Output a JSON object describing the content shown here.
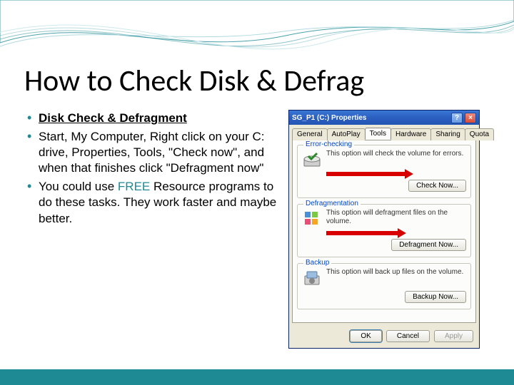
{
  "slide": {
    "title": "How to Check Disk & Defrag",
    "bullets": [
      {
        "text": "Disk Check & Defragment",
        "style": "bold-under"
      },
      {
        "text": "Start, My Computer, Right click on your C: drive, Properties, Tools, \"Check now\",  and when that finishes click \"Defragment now\""
      },
      {
        "html": "You could use <span class=\"free\">FREE</span> Resource programs to do these tasks. They work faster and maybe better."
      }
    ]
  },
  "dialog": {
    "title": "SG_P1 (C:) Properties",
    "help": "?",
    "close": "×",
    "tabs": [
      "General",
      "AutoPlay",
      "Tools",
      "Hardware",
      "Sharing",
      "Quota"
    ],
    "active_tab": 2,
    "groups": {
      "error": {
        "label": "Error-checking",
        "text": "This option will check the volume for errors.",
        "button": "Check Now..."
      },
      "defrag": {
        "label": "Defragmentation",
        "text": "This option will defragment files on the volume.",
        "button": "Defragment Now..."
      },
      "backup": {
        "label": "Backup",
        "text": "This option will back up files on the volume.",
        "button": "Backup Now..."
      }
    },
    "buttons": {
      "ok": "OK",
      "cancel": "Cancel",
      "apply": "Apply"
    }
  }
}
